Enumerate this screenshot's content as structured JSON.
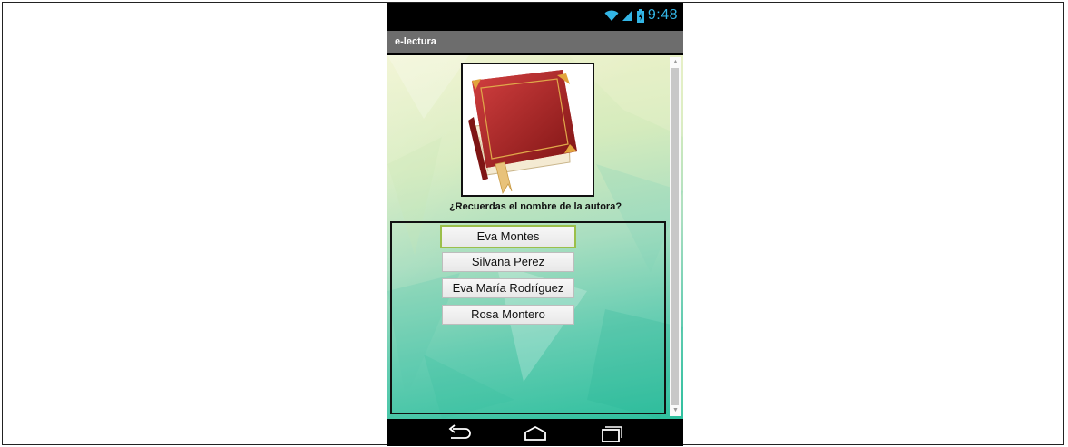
{
  "status_bar": {
    "time": "9:48"
  },
  "app": {
    "title": "e-lectura"
  },
  "question": "¿Recuerdas el nombre de la autora?",
  "answers": [
    {
      "label": "Eva Montes"
    },
    {
      "label": "Silvana Perez"
    },
    {
      "label": "Eva María Rodríguez"
    },
    {
      "label": "Rosa Montero"
    }
  ],
  "icons": {
    "wifi": "wifi-icon",
    "signal": "signal-icon",
    "battery": "battery-icon",
    "back": "back-icon",
    "home": "home-icon",
    "recents": "recent-apps-icon",
    "book": "book-image"
  },
  "colors": {
    "status_accent": "#33b5e5",
    "titlebar": "#6d6d6d",
    "focus": "#9bbf4a"
  }
}
